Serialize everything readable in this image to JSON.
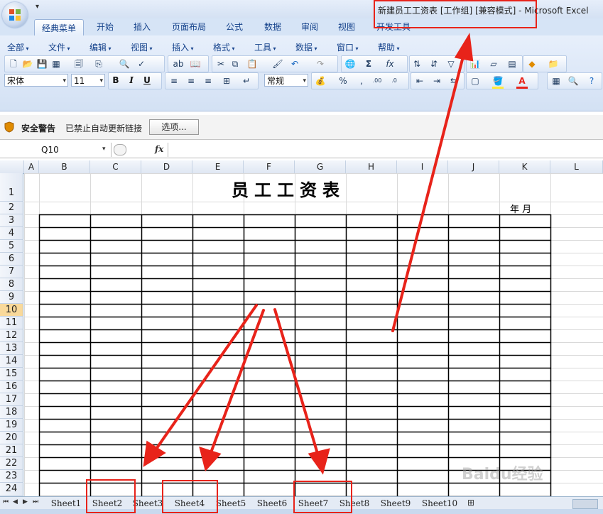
{
  "window": {
    "title": "新建员工工资表  [工作组]  [兼容模式] - Microsoft Excel",
    "qat_arrow": "▾"
  },
  "ribbon_tabs": [
    "经典菜单",
    "开始",
    "插入",
    "页面布局",
    "公式",
    "数据",
    "审阅",
    "视图",
    "开发工具"
  ],
  "menus": [
    "全部",
    "文件",
    "编辑",
    "视图",
    "插入",
    "格式",
    "工具",
    "数据",
    "窗口",
    "帮助"
  ],
  "format": {
    "font": "宋体",
    "size": "11",
    "number_format": "常规",
    "bold": "B",
    "italic": "I",
    "underline": "U"
  },
  "security": {
    "label": "安全警告",
    "message": "已禁止自动更新链接",
    "options_button": "选项..."
  },
  "formula_bar": {
    "name_box": "Q10",
    "fx": "fx",
    "value": ""
  },
  "columns": [
    "A",
    "B",
    "C",
    "D",
    "E",
    "F",
    "G",
    "H",
    "I",
    "J",
    "K",
    "L"
  ],
  "rows": [
    "1",
    "2",
    "3",
    "4",
    "5",
    "6",
    "7",
    "8",
    "9",
    "10",
    "11",
    "12",
    "13",
    "14",
    "15",
    "16",
    "17",
    "18",
    "19",
    "20",
    "21",
    "22",
    "23",
    "24"
  ],
  "selected_row": "10",
  "sheet": {
    "title": "员工工资表",
    "date_label": "年     月"
  },
  "sheet_tabs": [
    "Sheet1",
    "Sheet2",
    "Sheet3",
    "Sheet4",
    "Sheet5",
    "Sheet6",
    "Sheet7",
    "Sheet8",
    "Sheet9",
    "Sheet10"
  ],
  "highlighted_tabs": [
    "Sheet2",
    "Sheet4",
    "Sheet7"
  ],
  "annotation_color": "#e8231a",
  "watermark": "Baidu经验"
}
